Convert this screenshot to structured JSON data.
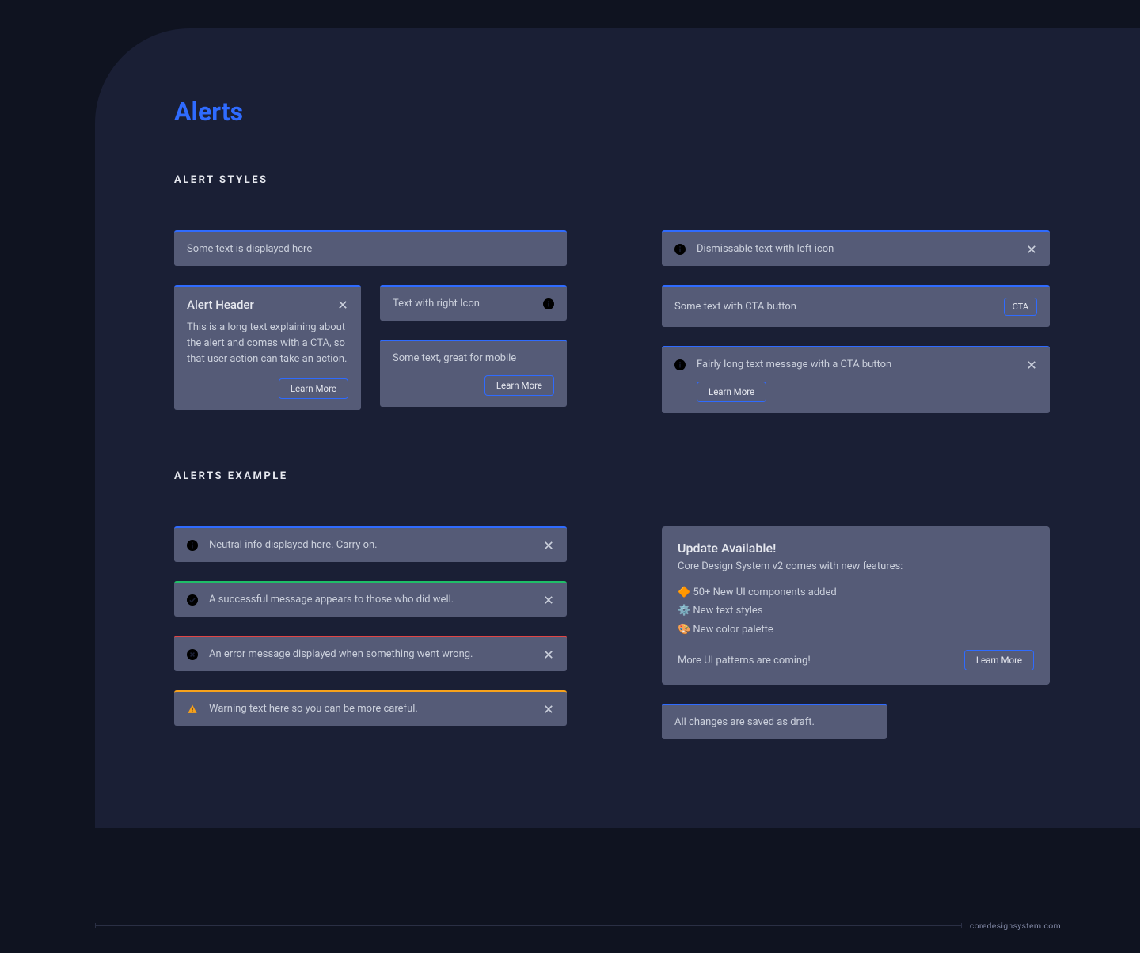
{
  "title": "Alerts",
  "sections": {
    "styles_label": "ALERT STYLES",
    "examples_label": "ALERTS EXAMPLE"
  },
  "styles": {
    "simple": "Some text is displayed here",
    "dismissable": "Dismissable text with left icon",
    "header_alert": {
      "title": "Alert Header",
      "body": "This is a long text explaining about the alert and comes with a CTA, so that user action can take an action.",
      "cta": "Learn More"
    },
    "right_icon": "Text with right Icon",
    "cta_inline": {
      "text": "Some text with CTA button",
      "cta": "CTA"
    },
    "mobile": {
      "text": "Some text, great for mobile",
      "cta": "Learn More"
    },
    "long_cta": {
      "text": "Fairly long text message with a CTA button",
      "cta": "Learn More"
    }
  },
  "examples": {
    "neutral": "Neutral info displayed here. Carry on.",
    "success": "A successful message appears to those who did well.",
    "error": "An error message displayed when something went wrong.",
    "warning": "Warning text here so you can be more careful.",
    "update": {
      "title": "Update Available!",
      "subtitle": "Core Design System v2 comes with new features:",
      "items": [
        "🔶 50+ New UI components added",
        "⚙️ New text styles",
        "🎨 New color palette"
      ],
      "footer": "More UI patterns are coming!",
      "cta": "Learn More"
    },
    "draft": "All changes are saved as draft."
  },
  "footer": "coredesignsystem.com"
}
